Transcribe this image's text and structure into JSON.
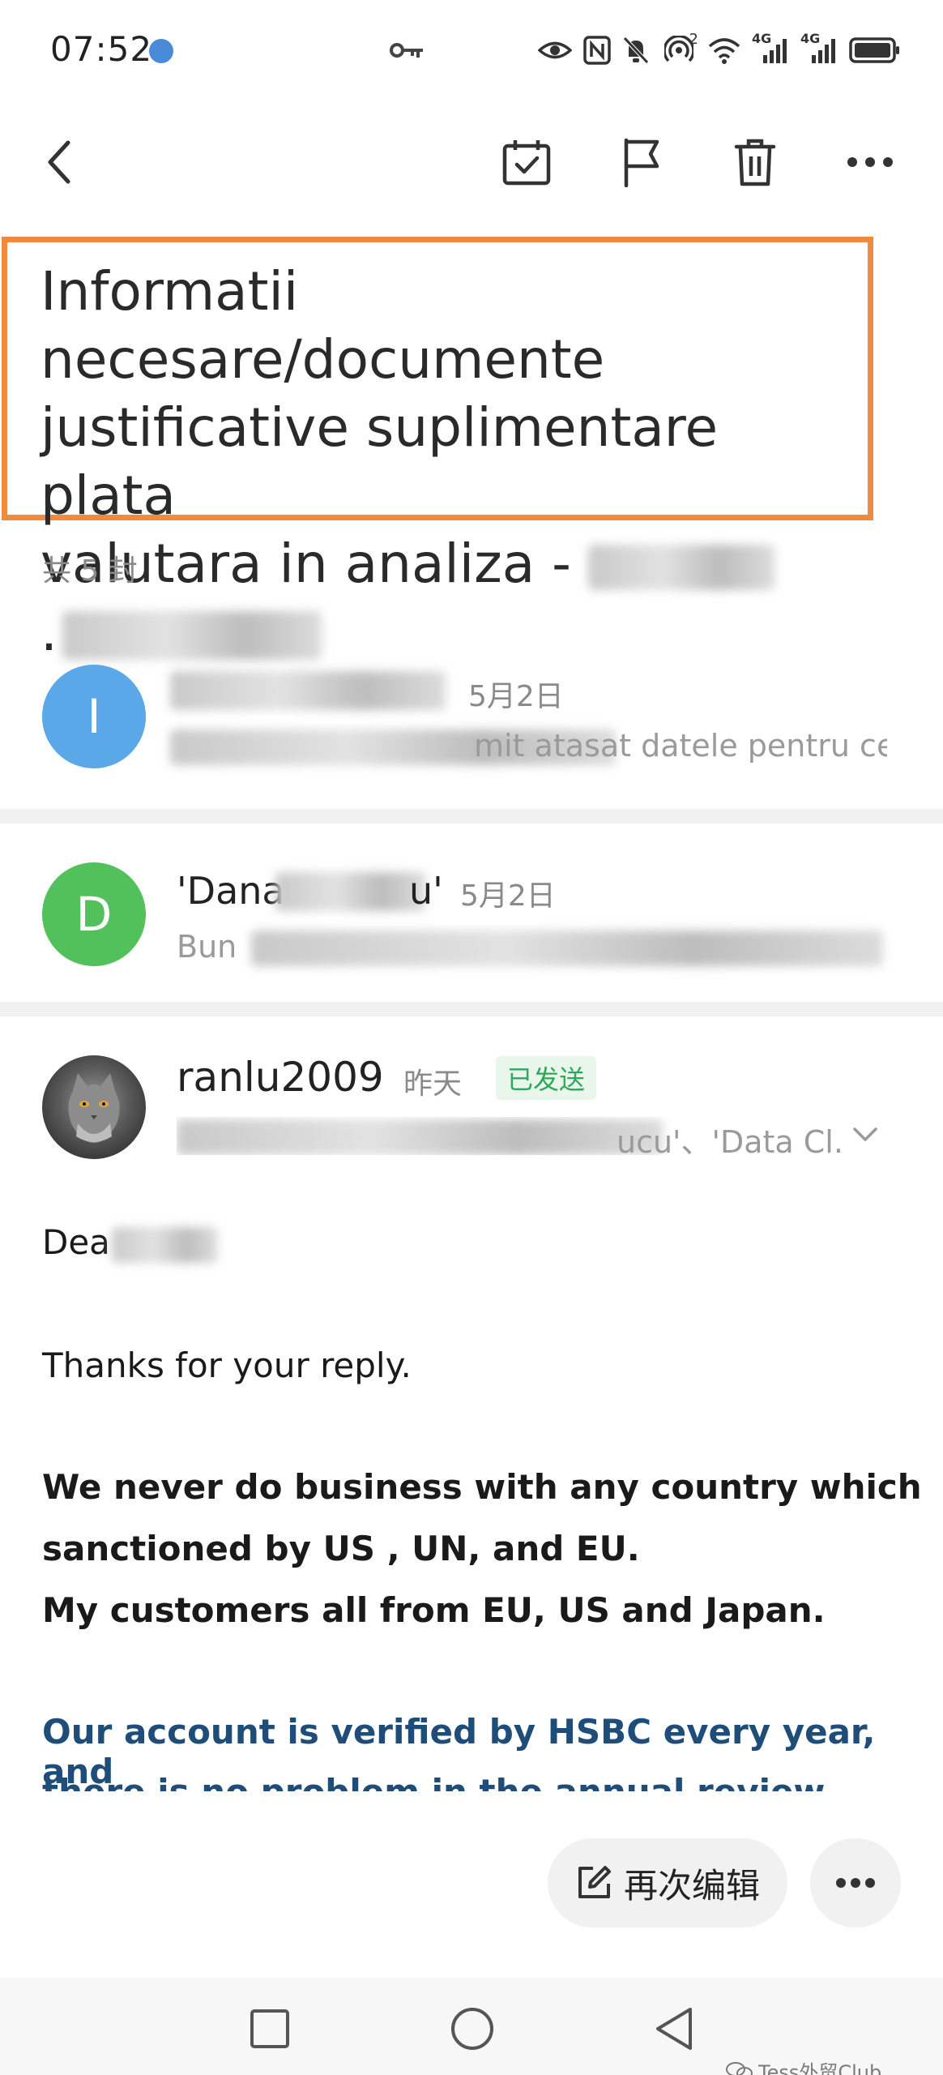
{
  "status_bar": {
    "time": "07:52",
    "network_labels": [
      "4G",
      "4G"
    ],
    "hotspot_count": "2"
  },
  "toolbar": {
    "icons": [
      "back-icon",
      "todo-icon",
      "flag-icon",
      "trash-icon",
      "more-icon"
    ]
  },
  "subject": {
    "line1": "Informatii necesare/documente",
    "line2": "justificative suplimentare plata",
    "line3": "valutara in analiza -",
    "line4": "."
  },
  "thread_count": "共 5 封",
  "messages": [
    {
      "avatar_letter": "I",
      "avatar_color": "#5aa8e8",
      "date": "5月2日",
      "snippet": "mit atasat datele pentru cel..."
    },
    {
      "avatar_letter": "D",
      "avatar_color": "#52c05b",
      "sender": "'Dana",
      "sender_tail": "u'",
      "date": "5月2日",
      "snippet": "Bun"
    }
  ],
  "current_message": {
    "sender": "ranlu2009",
    "date": "昨天",
    "badge": "已发送",
    "recipients_visible": "ucu'、'Data Cl..."
  },
  "body": {
    "greeting": "Dea",
    "line1": "Thanks for your reply.",
    "bold_line1": "We never do business with any country which",
    "bold_line2": "sanctioned by US , UN, and EU.",
    "bold_line3": "My customers all from EU, US and Japan.",
    "blue_line1": "Our account is verified by HSBC every year, and",
    "blue_line2": "there is no problem in the annual review"
  },
  "actions": {
    "edit_again": "再次编辑"
  },
  "watermark": "Tess外贸Club",
  "colors": {
    "highlight_border": "#ef8a3f",
    "sent_badge": "#2fa85a",
    "link_blue": "#1e4d7a"
  }
}
